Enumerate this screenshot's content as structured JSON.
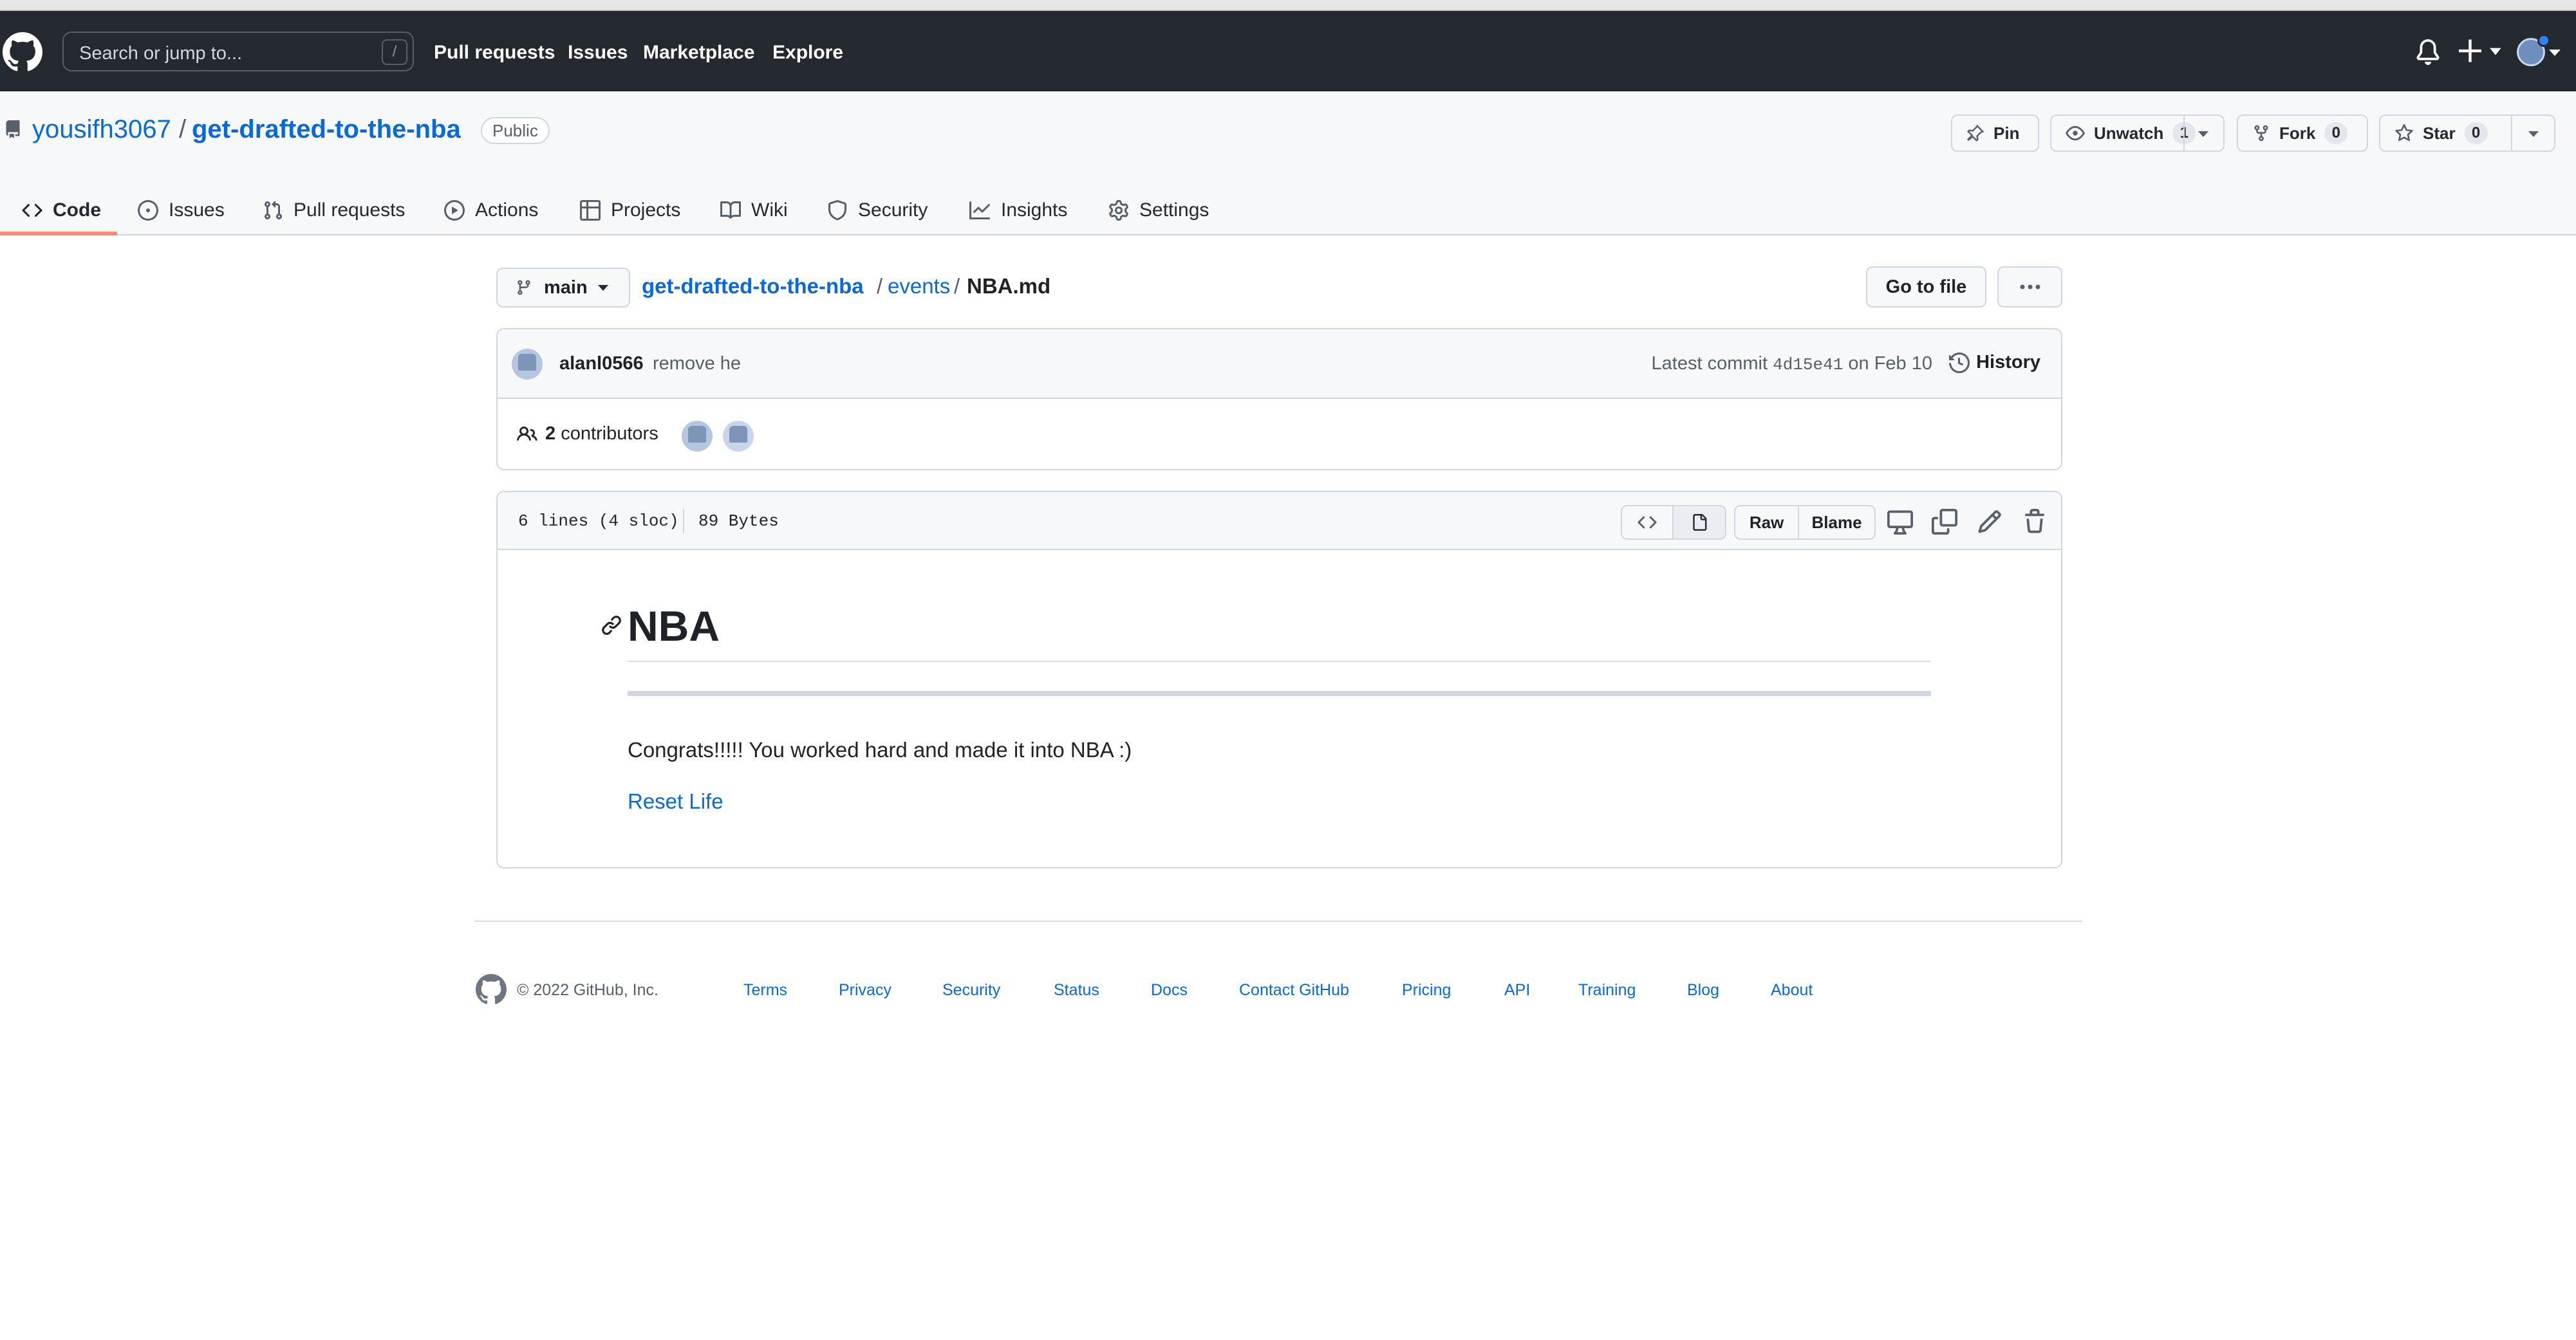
{
  "search": {
    "placeholder": "Search or jump to...",
    "shortcut": "/"
  },
  "topnav": [
    "Pull requests",
    "Issues",
    "Marketplace",
    "Explore"
  ],
  "repo": {
    "owner": "yousifh3067",
    "separator": "/",
    "name": "get-drafted-to-the-nba",
    "visibility": "Public",
    "pin_label": "Pin",
    "unwatch_label": "Unwatch",
    "watch_count": "1",
    "fork_label": "Fork",
    "fork_count": "0",
    "star_label": "Star",
    "star_count": "0"
  },
  "tabs": [
    {
      "label": "Code",
      "icon": "code-icon"
    },
    {
      "label": "Issues",
      "icon": "issue-icon"
    },
    {
      "label": "Pull requests",
      "icon": "pull-request-icon"
    },
    {
      "label": "Actions",
      "icon": "play-icon"
    },
    {
      "label": "Projects",
      "icon": "table-icon"
    },
    {
      "label": "Wiki",
      "icon": "book-icon"
    },
    {
      "label": "Security",
      "icon": "shield-icon"
    },
    {
      "label": "Insights",
      "icon": "graph-icon"
    },
    {
      "label": "Settings",
      "icon": "gear-icon"
    }
  ],
  "file_nav": {
    "branch": "main",
    "crumbs": [
      "get-drafted-to-the-nba",
      "/",
      "events",
      "/",
      "NBA.md"
    ],
    "go_to_file": "Go to file"
  },
  "commit": {
    "author": "alanl0566",
    "message": "remove he",
    "latest_prefix": "Latest commit",
    "sha": "4d15e41",
    "date": "on Feb 10",
    "history": "History",
    "contributors_count": "2",
    "contributors_label": "contributors"
  },
  "file": {
    "lines": "6 lines (4 sloc)",
    "size": "89 Bytes",
    "raw": "Raw",
    "blame": "Blame"
  },
  "markdown": {
    "heading": "NBA",
    "paragraph": "Congrats!!!!! You worked hard and made it into NBA :)",
    "link": "Reset Life"
  },
  "footer": {
    "copyright": "© 2022 GitHub, Inc.",
    "links": [
      "Terms",
      "Privacy",
      "Security",
      "Status",
      "Docs",
      "Contact GitHub",
      "Pricing",
      "API",
      "Training",
      "Blog",
      "About"
    ]
  },
  "colors": {
    "header_bg": "#24292f",
    "link": "#0969da",
    "tab_underline": "#fd8c73",
    "border": "#d0d7de"
  }
}
